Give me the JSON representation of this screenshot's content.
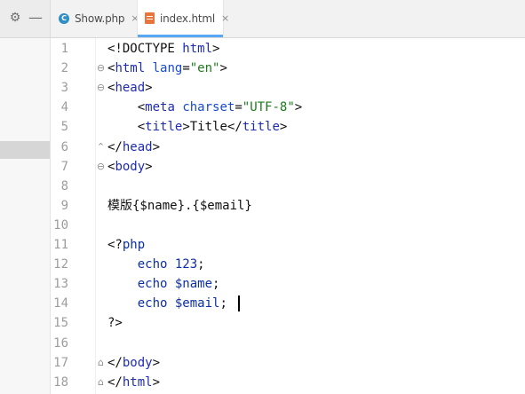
{
  "toolbar": {
    "gear_icon": "gear-icon",
    "minimize_icon": "minimize-icon",
    "gear_symbol": "⚙",
    "minus_symbol": "—"
  },
  "tabs": [
    {
      "label": "Show.php",
      "icon": "php-file-icon",
      "icon_letter": "C",
      "close": "×"
    },
    {
      "label": "index.html",
      "icon": "html-file-icon",
      "close": "×",
      "active": true
    }
  ],
  "colors": {
    "tag": "#1e2bb3",
    "attribute": "#174ad4",
    "string": "#1c7a1c",
    "active_tab_underline": "#56a8f5"
  },
  "editor": {
    "lines": [
      {
        "n": "1",
        "fold": "",
        "html": "&lt;!DOCTYPE <span class='tag'>html</span>&gt;"
      },
      {
        "n": "2",
        "fold": "⊖",
        "html": "&lt;<span class='tag'>html</span> <span class='attr'>lang</span>=<span class='str'>\"en\"</span>&gt;"
      },
      {
        "n": "3",
        "fold": "⊖",
        "html": "&lt;<span class='tag'>head</span>&gt;"
      },
      {
        "n": "4",
        "fold": "",
        "html": "    &lt;<span class='tag'>meta</span> <span class='attr'>charset</span>=<span class='str'>\"UTF-8\"</span>&gt;"
      },
      {
        "n": "5",
        "fold": "",
        "html": "    &lt;<span class='tag'>title</span>&gt;Title&lt;/<span class='tag'>title</span>&gt;"
      },
      {
        "n": "6",
        "fold": "⌃",
        "html": "&lt;/<span class='tag'>head</span>&gt;"
      },
      {
        "n": "7",
        "fold": "⊖",
        "html": "&lt;<span class='tag'>body</span>&gt;"
      },
      {
        "n": "8",
        "fold": "",
        "html": ""
      },
      {
        "n": "9",
        "fold": "",
        "html": "<span class='cn'>模版</span>{$name}.{$email}"
      },
      {
        "n": "10",
        "fold": "",
        "html": ""
      },
      {
        "n": "11",
        "fold": "",
        "html": "&lt;?<span class='kw'>php</span>"
      },
      {
        "n": "12",
        "fold": "",
        "html": "    <span class='kw'>echo</span> <span class='kw'>123</span>;"
      },
      {
        "n": "13",
        "fold": "",
        "html": "    <span class='kw'>echo</span> <span class='kw'>$name</span>;"
      },
      {
        "n": "14",
        "fold": "",
        "html": "    <span class='kw'>echo</span> <span class='kw'>$email</span>;"
      },
      {
        "n": "15",
        "fold": "",
        "html": "?&gt;"
      },
      {
        "n": "16",
        "fold": "",
        "html": ""
      },
      {
        "n": "17",
        "fold": "⌂",
        "html": "&lt;/<span class='tag'>body</span>&gt;"
      },
      {
        "n": "18",
        "fold": "⌂",
        "html": "&lt;/<span class='tag'>html</span>&gt;"
      }
    ]
  }
}
